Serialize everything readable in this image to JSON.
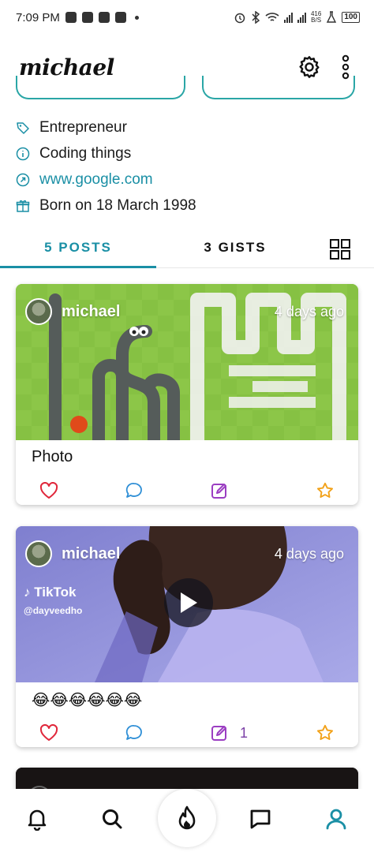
{
  "status_bar": {
    "time": "7:09 PM",
    "net_speed_top": "416",
    "net_speed_bottom": "B/S",
    "battery": "100"
  },
  "header": {
    "title": "michael",
    "settings_icon": "gear-icon",
    "menu_icon": "more-vertical-icon"
  },
  "profile": {
    "occupation": "Entrepreneur",
    "bio": "Coding things",
    "website": "www.google.com",
    "birthday": "Born on 18 March 1998"
  },
  "tabs": {
    "posts": "5 POSTS",
    "gists": "3 GISTS",
    "active": "posts"
  },
  "posts": [
    {
      "username": "michael",
      "time": "4 days ago",
      "caption": "Photo",
      "edit_count": ""
    },
    {
      "username": "michael",
      "time": "4 days ago",
      "caption": "😂😂😂😂😂😂",
      "edit_count": "1",
      "overlay_brand": "TikTok",
      "overlay_handle": "@dayveedho"
    }
  ],
  "colors": {
    "accent": "#1a8fa5",
    "like": "#e0263a",
    "comment": "#2f8fd6",
    "edit": "#9b3ec2",
    "star": "#f2a21a"
  },
  "bottom_nav": [
    "bell-icon",
    "search-icon",
    "fire-icon",
    "chat-icon",
    "profile-icon"
  ]
}
